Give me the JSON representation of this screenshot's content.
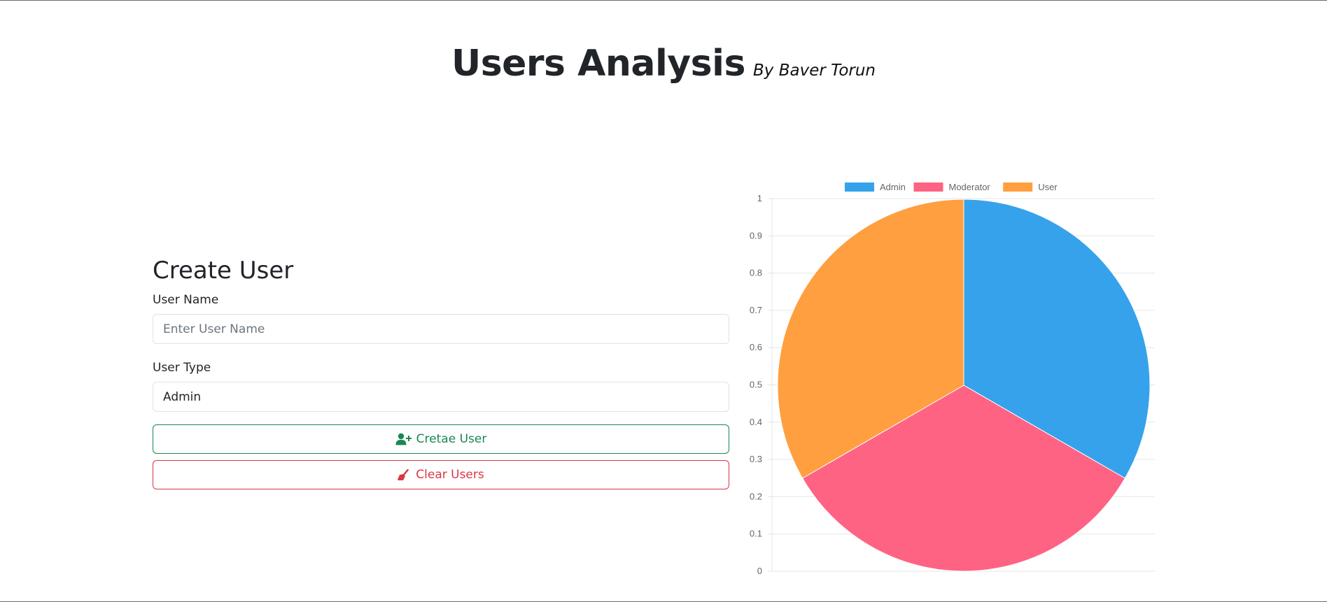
{
  "header": {
    "title": "Users Analysis",
    "subtitle": "By Baver Torun"
  },
  "form": {
    "heading": "Create User",
    "user_name_label": "User Name",
    "user_name_placeholder": "Enter User Name",
    "user_name_value": "",
    "user_type_label": "User Type",
    "user_type_value": "Admin",
    "create_button_label": "Cretae User",
    "create_button_icon": "user-plus-icon",
    "clear_button_label": "Clear Users",
    "clear_button_icon": "broom-icon"
  },
  "chart_data": {
    "type": "pie",
    "categories": [
      "Admin",
      "Moderator",
      "User"
    ],
    "values": [
      1,
      1,
      1
    ],
    "colors": [
      "#36a2eb",
      "#ff6384",
      "#ff9f40"
    ],
    "legend": "top",
    "y_axis_ticks": [
      "1",
      "0.9",
      "0.8",
      "0.7",
      "0.6",
      "0.5",
      "0.4",
      "0.3",
      "0.2",
      "0.1",
      "0"
    ],
    "ylim": [
      0,
      1
    ],
    "grid": true
  }
}
